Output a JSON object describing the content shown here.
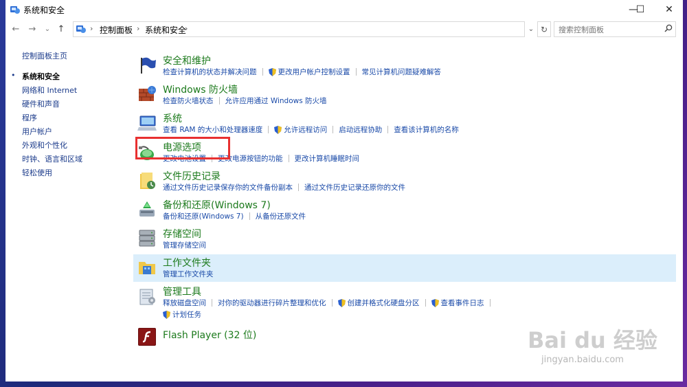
{
  "window": {
    "title": "系统和安全"
  },
  "window_controls": {
    "minimize": "—",
    "maximize": "☐",
    "close": "✕"
  },
  "nav": {
    "back": "←",
    "forward": "→",
    "recent": "⌄",
    "up": "↑"
  },
  "address": {
    "breadcrumbs": [
      "控制面板",
      "系统和安全"
    ],
    "refresh": "↻",
    "dropdown": "⌄"
  },
  "search": {
    "placeholder": "搜索控制面板",
    "icon": "search-icon"
  },
  "sidebar": {
    "home": "控制面板主页",
    "items": [
      {
        "label": "系统和安全",
        "active": true
      },
      {
        "label": "网络和 Internet"
      },
      {
        "label": "硬件和声音"
      },
      {
        "label": "程序"
      },
      {
        "label": "用户帐户"
      },
      {
        "label": "外观和个性化"
      },
      {
        "label": "时钟、语言和区域"
      },
      {
        "label": "轻松使用"
      }
    ]
  },
  "categories": [
    {
      "title": "安全和维护",
      "icon": "flag-icon",
      "links": [
        {
          "label": "检查计算机的状态并解决问题"
        },
        {
          "label": "更改用户帐户控制设置",
          "shield": true
        },
        {
          "label": "常见计算机问题疑难解答"
        }
      ]
    },
    {
      "title": "Windows 防火墙",
      "icon": "firewall-icon",
      "links": [
        {
          "label": "检查防火墙状态"
        },
        {
          "label": "允许应用通过 Windows 防火墙"
        }
      ]
    },
    {
      "title": "系统",
      "icon": "computer-icon",
      "links": [
        {
          "label": "查看 RAM 的大小和处理器速度"
        },
        {
          "label": "允许远程访问",
          "shield": true
        },
        {
          "label": "启动远程协助"
        },
        {
          "label": "查看该计算机的名称"
        }
      ]
    },
    {
      "title": "电源选项",
      "icon": "power-options-icon",
      "links": [
        {
          "label": "更改电池设置"
        },
        {
          "label": "更改电源按钮的功能"
        },
        {
          "label": "更改计算机睡眠时间"
        }
      ]
    },
    {
      "title": "文件历史记录",
      "icon": "file-history-icon",
      "links": [
        {
          "label": "通过文件历史记录保存你的文件备份副本"
        },
        {
          "label": "通过文件历史记录还原你的文件"
        }
      ]
    },
    {
      "title": "备份和还原(Windows 7)",
      "icon": "backup-icon",
      "links": [
        {
          "label": "备份和还原(Windows 7)"
        },
        {
          "label": "从备份还原文件"
        }
      ]
    },
    {
      "title": "存储空间",
      "icon": "storage-icon",
      "links": [
        {
          "label": "管理存储空间"
        }
      ]
    },
    {
      "title": "工作文件夹",
      "icon": "work-folders-icon",
      "highlighted": true,
      "links": [
        {
          "label": "管理工作文件夹"
        }
      ]
    },
    {
      "title": "管理工具",
      "icon": "admin-tools-icon",
      "links": [
        {
          "label": "释放磁盘空间"
        },
        {
          "label": "对你的驱动器进行碎片整理和优化"
        },
        {
          "label": "创建并格式化硬盘分区",
          "shield": true
        },
        {
          "label": "查看事件日志",
          "shield": true
        }
      ],
      "links2": [
        {
          "label": "计划任务",
          "shield": true
        }
      ]
    },
    {
      "title": "Flash Player (32 位)",
      "icon": "flash-player-icon",
      "links": []
    }
  ],
  "watermark": {
    "logo": "Bai du 经验",
    "url": "jingyan.baidu.com"
  },
  "colors": {
    "link": "#1a4aa8",
    "category_title": "#1c7a1c",
    "highlight_row": "#dbeefb",
    "annotation_box": "#e83030"
  }
}
